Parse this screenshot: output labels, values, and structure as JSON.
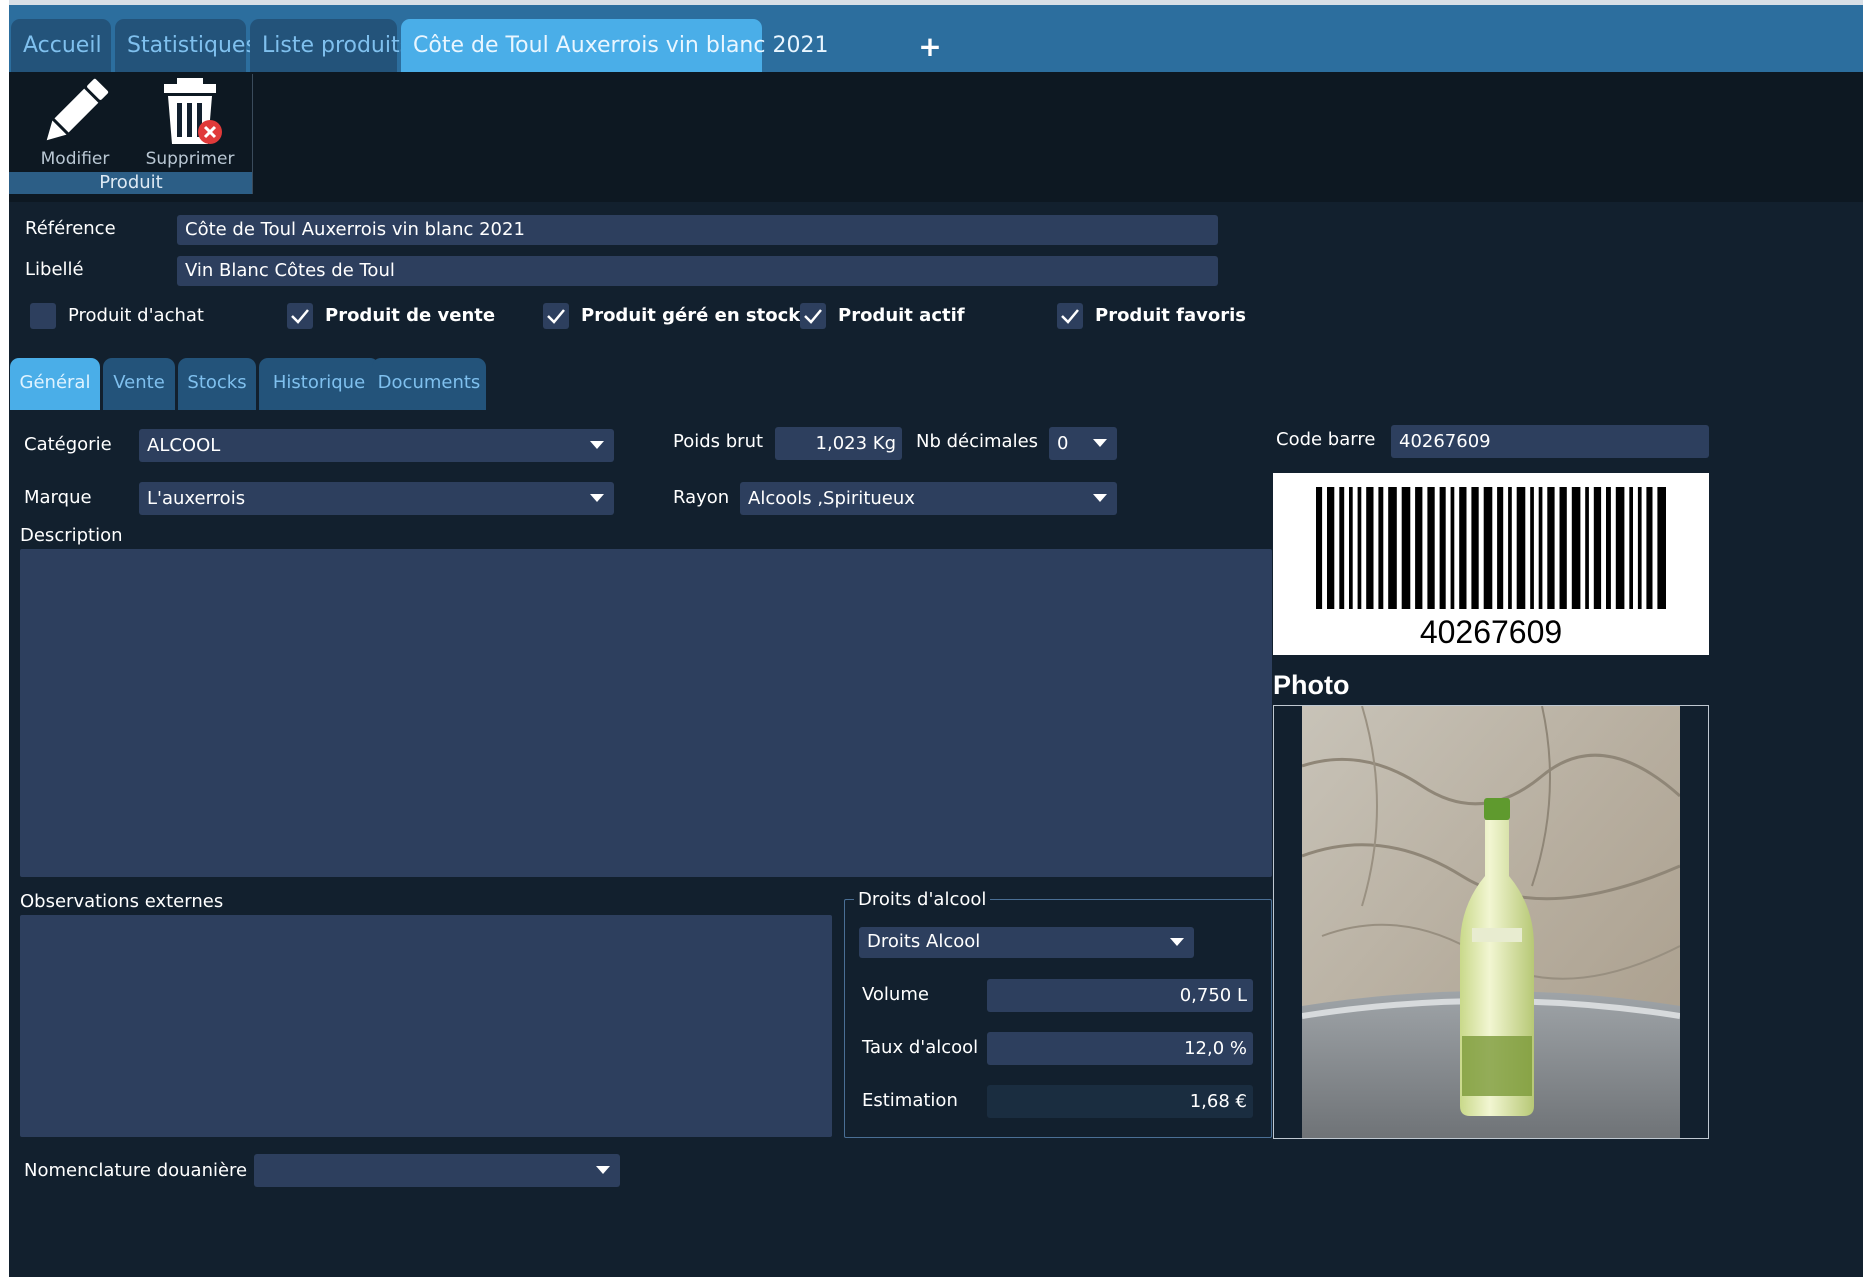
{
  "tabs": [
    {
      "label": "Accueil"
    },
    {
      "label": "Statistiques"
    },
    {
      "label": "Liste produits"
    },
    {
      "label": "Côte de Toul Auxerrois vin blanc 2021"
    }
  ],
  "tab_add_label": "+",
  "toolbar": {
    "modify_label": "Modifier",
    "delete_label": "Supprimer",
    "group_label": "Produit"
  },
  "product": {
    "reference_label": "Référence",
    "reference_value": "Côte de Toul Auxerrois vin blanc 2021",
    "libelle_label": "Libellé",
    "libelle_value": "Vin Blanc Côtes de Toul"
  },
  "flags": [
    {
      "label": "Produit d'achat",
      "checked": false
    },
    {
      "label": "Produit de vente",
      "checked": true
    },
    {
      "label": "Produit géré en stock",
      "checked": true
    },
    {
      "label": "Produit actif",
      "checked": true
    },
    {
      "label": "Produit favoris",
      "checked": true
    }
  ],
  "inner_tabs": [
    {
      "label": "Général"
    },
    {
      "label": "Vente"
    },
    {
      "label": "Stocks"
    },
    {
      "label": "Historique"
    },
    {
      "label": "Documents"
    }
  ],
  "general": {
    "category_label": "Catégorie",
    "category_value": "ALCOOL",
    "brand_label": "Marque",
    "brand_value": "L'auxerrois",
    "weight_label": "Poids brut",
    "weight_value": "1,023 Kg",
    "decimals_label": "Nb décimales",
    "decimals_value": "0",
    "shelf_label": "Rayon",
    "shelf_value": "Alcools ,Spiritueux",
    "description_label": "Description",
    "description_value": "",
    "external_obs_label": "Observations externes",
    "external_obs_value": "",
    "customs_label": "Nomenclature douanière",
    "customs_value": ""
  },
  "alcohol": {
    "group_title": "Droits d'alcool",
    "type_value": "Droits Alcool",
    "volume_label": "Volume",
    "volume_value": "0,750 L",
    "rate_label": "Taux d'alcool",
    "rate_value": "12,0 %",
    "estimate_label": "Estimation",
    "estimate_value": "1,68 €"
  },
  "barcode": {
    "label": "Code barre",
    "value": "40267609",
    "printed": "40267609"
  },
  "photo": {
    "title": "Photo"
  },
  "colors": {
    "background": "#12202e",
    "tab_bar": "#2c6e9e",
    "tab_active": "#4aaee8",
    "field": "#2d3f5e"
  },
  "icons": [
    "pencil-icon",
    "trash-icon",
    "checkmark-icon",
    "dropdown-caret-icon"
  ]
}
